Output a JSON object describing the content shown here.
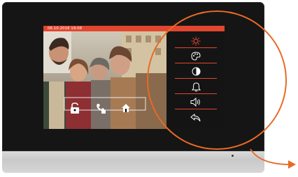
{
  "status_bar": {
    "datetime": "06.10.2018   19:08"
  },
  "overlay_icons": [
    "unlock-icon",
    "phone-hand-icon",
    "house-hand-icon"
  ],
  "menu": {
    "items": [
      {
        "name": "brightness",
        "icon": "sun-icon"
      },
      {
        "name": "color",
        "icon": "palette-icon"
      },
      {
        "name": "contrast",
        "icon": "contrast-icon"
      },
      {
        "name": "ringtone",
        "icon": "bell-icon"
      },
      {
        "name": "volume",
        "icon": "speaker-icon"
      },
      {
        "name": "back",
        "icon": "return-arrow-icon"
      }
    ]
  },
  "colors": {
    "accent": "#e2462f",
    "highlight_ring": "#e86a24",
    "menu_bg": "#141414",
    "bezel": "#151515"
  }
}
